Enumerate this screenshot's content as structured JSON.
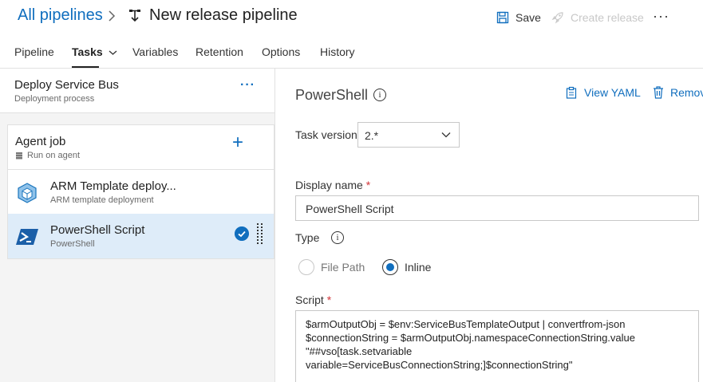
{
  "header": {
    "breadcrumb_root": "All pipelines",
    "title": "New release pipeline",
    "save_label": "Save",
    "create_release_label": "Create release",
    "more_label": "···"
  },
  "tabs": [
    {
      "label": "Pipeline"
    },
    {
      "label": "Tasks",
      "active": true
    },
    {
      "label": "Variables"
    },
    {
      "label": "Retention"
    },
    {
      "label": "Options"
    },
    {
      "label": "History"
    }
  ],
  "stage": {
    "name": "Deploy Service Bus",
    "subtitle": "Deployment process",
    "more_label": "···"
  },
  "agent_job": {
    "name": "Agent job",
    "subtitle": "Run on agent",
    "add_label": "+"
  },
  "tasks": [
    {
      "name": "ARM Template deploy...",
      "subtitle": "ARM template deployment",
      "icon": "arm-template-icon"
    },
    {
      "name": "PowerShell Script",
      "subtitle": "PowerShell",
      "icon": "powershell-icon",
      "selected": true
    }
  ],
  "detail": {
    "title": "PowerShell",
    "view_yaml_label": "View YAML",
    "remove_label": "Remove",
    "task_version_label": "Task version",
    "task_version_value": "2.*",
    "display_name_label": "Display name",
    "display_name_value": "PowerShell Script",
    "type_label": "Type",
    "type_options": [
      {
        "label": "File Path",
        "selected": false
      },
      {
        "label": "Inline",
        "selected": true
      }
    ],
    "script_label": "Script",
    "script_lines": [
      "$armOutputObj = $env:ServiceBusTemplateOutput | convertfrom-json",
      "$connectionString = $armOutputObj.namespaceConnectionString.value",
      "\"##vso[task.setvariable",
      "variable=ServiceBusConnectionString;]$connectionString\""
    ]
  },
  "colors": {
    "accent": "#106ebe",
    "selected_row": "#deecf9",
    "required": "#d13438"
  }
}
